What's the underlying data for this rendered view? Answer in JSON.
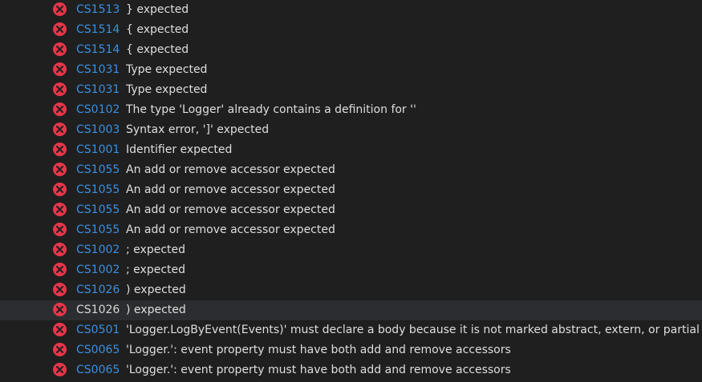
{
  "colors": {
    "background": "#1f1f1f",
    "selected_row": "#2b2d30",
    "error_icon": "#e5364a",
    "code_link": "#3a8fe0",
    "message_text": "#dedede"
  },
  "error_list": {
    "icon": "error-circle-icon",
    "selected_index": 15,
    "rows": [
      {
        "code": "CS1513",
        "message": "} expected"
      },
      {
        "code": "CS1514",
        "message": "{ expected"
      },
      {
        "code": "CS1514",
        "message": "{ expected"
      },
      {
        "code": "CS1031",
        "message": "Type expected"
      },
      {
        "code": "CS1031",
        "message": "Type expected"
      },
      {
        "code": "CS0102",
        "message": "The type 'Logger' already contains a definition for ''"
      },
      {
        "code": "CS1003",
        "message": "Syntax error, ']' expected"
      },
      {
        "code": "CS1001",
        "message": "Identifier expected"
      },
      {
        "code": "CS1055",
        "message": "An add or remove accessor expected"
      },
      {
        "code": "CS1055",
        "message": "An add or remove accessor expected"
      },
      {
        "code": "CS1055",
        "message": "An add or remove accessor expected"
      },
      {
        "code": "CS1055",
        "message": "An add or remove accessor expected"
      },
      {
        "code": "CS1002",
        "message": "; expected"
      },
      {
        "code": "CS1002",
        "message": "; expected"
      },
      {
        "code": "CS1026",
        "message": ") expected"
      },
      {
        "code": "CS1026",
        "message": ") expected"
      },
      {
        "code": "CS0501",
        "message": "'Logger.LogByEvent(Events)' must declare a body because it is not marked abstract, extern, or partial"
      },
      {
        "code": "CS0065",
        "message": "'Logger.': event property must have both add and remove accessors"
      },
      {
        "code": "CS0065",
        "message": "'Logger.': event property must have both add and remove accessors"
      }
    ]
  }
}
